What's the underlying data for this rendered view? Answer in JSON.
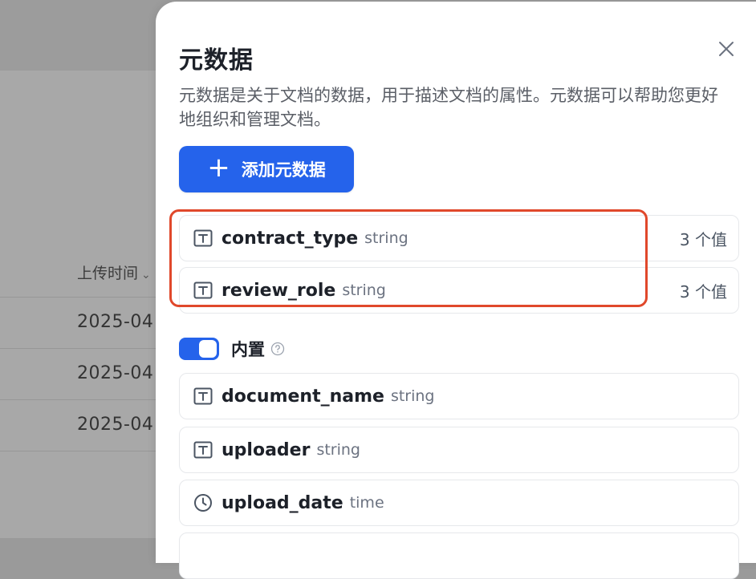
{
  "background": {
    "column_header": "上传时间",
    "rows": [
      "2025-04",
      "2025-04",
      "2025-04"
    ]
  },
  "drawer": {
    "title": "元数据",
    "description": "元数据是关于文档的数据，用于描述文档的属性。元数据可以帮助您更好地组织和管理文档。",
    "add_button_label": "添加元数据"
  },
  "custom_metadata": [
    {
      "name": "contract_type",
      "type": "string",
      "count": "3 个值",
      "icon": "text-type-icon"
    },
    {
      "name": "review_role",
      "type": "string",
      "count": "3 个值",
      "icon": "text-type-icon"
    }
  ],
  "builtin": {
    "label": "内置",
    "enabled": true
  },
  "builtin_metadata": [
    {
      "name": "document_name",
      "type": "string",
      "icon": "text-type-icon"
    },
    {
      "name": "uploader",
      "type": "string",
      "icon": "text-type-icon"
    },
    {
      "name": "upload_date",
      "type": "time",
      "icon": "clock-icon"
    }
  ],
  "colors": {
    "primary": "#2563eb",
    "highlight": "#e0482b"
  }
}
